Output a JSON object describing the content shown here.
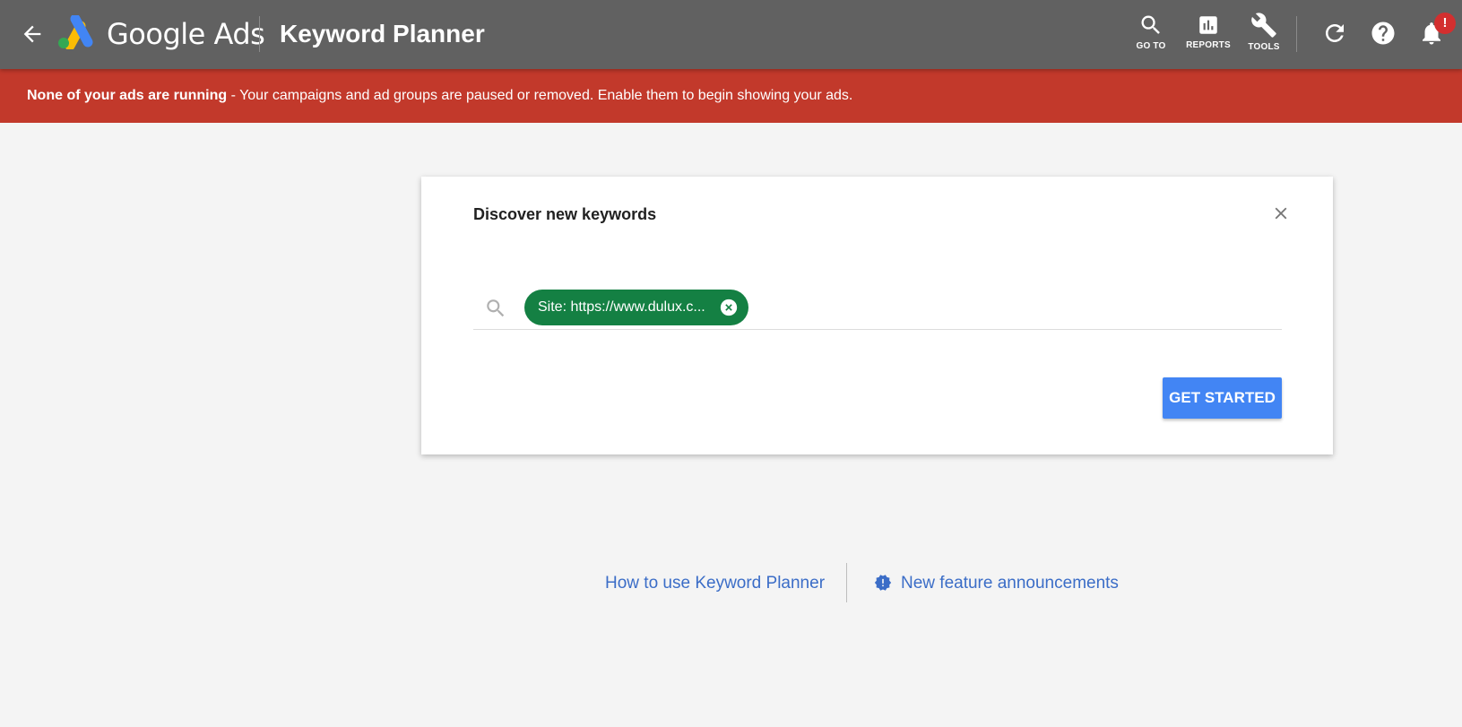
{
  "header": {
    "product_name": "Google Ads",
    "page_title": "Keyword Planner",
    "tools": [
      {
        "label": "GO TO",
        "icon": "search-icon"
      },
      {
        "label": "REPORTS",
        "icon": "reports-icon"
      },
      {
        "label": "TOOLS",
        "icon": "wrench-icon"
      }
    ],
    "notification_badge": "!"
  },
  "alert": {
    "bold_text": "None of your ads are running",
    "text": " - Your campaigns and ad groups are paused or removed. Enable them to begin showing your ads.",
    "color": "#c2392b"
  },
  "dialog": {
    "title": "Discover new keywords",
    "chip_label": "Site: https://www.dulux.c...",
    "chip_color": "#148043",
    "button_label": "GET STARTED",
    "button_color": "#4285f4"
  },
  "links": {
    "how_to": "How to use Keyword Planner",
    "announcements": "New feature announcements"
  }
}
